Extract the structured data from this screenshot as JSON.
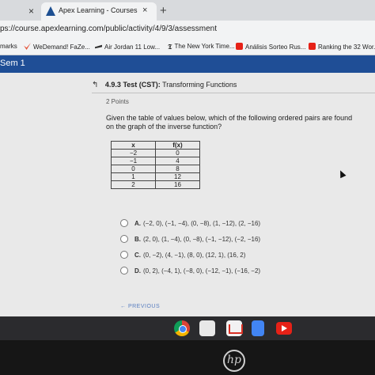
{
  "browser": {
    "prev_tab_close": "×",
    "active_tab_title": "Apex Learning - Courses",
    "active_tab_close": "×",
    "new_tab": "+",
    "url": "ps://course.apexlearning.com/public/activity/4/9/3/assessment",
    "bookmarks": [
      {
        "label": "marks",
        "icon": "bookmarks-icon",
        "color": "#f2f3f4"
      },
      {
        "label": "WeDemand! FaZe...",
        "icon": "wedemand-icon",
        "color": "#e5553b"
      },
      {
        "label": "Air Jordan 11 Low...",
        "icon": "jordan-icon",
        "color": "#333333"
      },
      {
        "label": "The New York Time...",
        "icon": "nyt-icon",
        "color": "#111111"
      },
      {
        "label": "Análisis Sorteo Rus...",
        "icon": "youtube-icon",
        "color": "#e62117"
      },
      {
        "label": "Ranking the 32 Wor...",
        "icon": "youtube-icon",
        "color": "#e62117"
      }
    ]
  },
  "course": {
    "header": "Sem 1"
  },
  "test": {
    "back_icon": "↰",
    "number": "4.9.3",
    "label": "Test (CST):",
    "name": "Transforming Functions",
    "points": "2 Points",
    "question": "Given the table of values below, which of the following ordered pairs are found on the graph of the inverse function?",
    "table": {
      "headers": [
        "x",
        "f(x)"
      ],
      "rows": [
        [
          "−2",
          "0"
        ],
        [
          "−1",
          "4"
        ],
        [
          "0",
          "8"
        ],
        [
          "1",
          "12"
        ],
        [
          "2",
          "16"
        ]
      ]
    },
    "options": [
      {
        "letter": "A.",
        "text": "(−2, 0), (−1, −4), (0, −8), (1, −12), (2, −16)"
      },
      {
        "letter": "B.",
        "text": "(2, 0), (1, −4), (0, −8), (−1, −12), (−2, −16)"
      },
      {
        "letter": "C.",
        "text": "(0, −2), (4, −1), (8, 0), (12, 1), (16, 2)"
      },
      {
        "letter": "D.",
        "text": "(0, 2), (−4, 1), (−8, 0), (−12, −1), (−16, −2)"
      }
    ],
    "previous": "← PREVIOUS"
  },
  "shelf": {
    "apps": [
      "chrome-icon",
      "files-icon",
      "gmail-icon",
      "docs-icon",
      "youtube-icon"
    ]
  },
  "laptop": {
    "logo": "hp"
  },
  "colors": {
    "course_header": "#1f4e96",
    "content_bg": "#e9e9e9",
    "link": "#5a7fc0"
  }
}
